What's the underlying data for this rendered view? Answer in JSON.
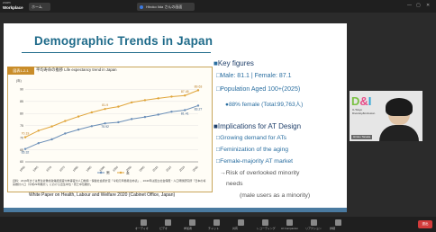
{
  "app": {
    "brand": "Workplace",
    "brand_small": "zoom"
  },
  "tabs": [
    {
      "label": "ホーム"
    },
    {
      "label": "Hiroko Iida さんの画面"
    }
  ],
  "slide": {
    "title": "Demographic Trends in Japan",
    "chart": {
      "tag": "図表1-2-1",
      "heading": "平均寿命の推移  Life expectancy trend in Japan",
      "note": "資料：2019年までは厚生労働省政策統括官付参事官付人口動態・保健社会統計室「令和元年簡易生命表」、2040年は国立社会保障・人口問題研究所「日本の将来推計人口（平成29年推計）」における出生中位・死亡中位推計。",
      "caption": "White Paper on Health, Labour and Welfare 2020 (Cabinet Office, Japan)"
    },
    "key_figures": {
      "title": "Key figures",
      "line1": "Male: 81.1 | Female: 87.1",
      "line2": "Population Aged 100+(2025)",
      "line3": "88% female (Total:99,763人)"
    },
    "implications": {
      "title": "Implications for AT Design",
      "items": [
        "Growing demand for ATs",
        "Feminization of the aging",
        "Female-majority AT market"
      ],
      "risk_line1": "Risk of overlooked minority",
      "risk_line2": "needs",
      "risk_line3": "(male users as a minority)"
    }
  },
  "chart_data": {
    "type": "line",
    "title": "平均寿命の推移 Life expectancy trend in Japan",
    "ylabel": "(年)",
    "categories": [
      "1960",
      "1965",
      "1970",
      "1975",
      "1980",
      "1985",
      "1990",
      "1995",
      "2000",
      "2005",
      "2010",
      "2015",
      "2019",
      "2040"
    ],
    "series": [
      {
        "name": "男",
        "values": [
          65.32,
          67.74,
          69.31,
          71.73,
          73.35,
          74.78,
          75.92,
          76.38,
          77.72,
          78.56,
          79.55,
          80.75,
          81.41,
          83.27
        ]
      },
      {
        "name": "女",
        "values": [
          70.19,
          72.92,
          74.66,
          76.89,
          78.76,
          80.48,
          81.9,
          82.85,
          84.6,
          85.52,
          86.3,
          86.99,
          87.45,
          89.63
        ]
      }
    ],
    "ylim": [
      60,
      92
    ],
    "yticks": [
      60,
      65,
      70,
      75,
      80,
      85,
      90
    ],
    "data_labels": [
      "65.32",
      "70.19",
      "81.9",
      "75.92",
      "87.45",
      "81.41",
      "89.63",
      "83.27"
    ],
    "legend": "bottom-center",
    "colors": {
      "male": "#6b8fb8",
      "female": "#e0a53a"
    }
  },
  "camera": {
    "name": "Hiroko Tanaka",
    "logo_text": "D&I",
    "logo_sub_1": "U-Tokyo",
    "logo_sub_2": "Diversity&Inclusion"
  },
  "toolbar": {
    "items": [
      "オーディオ",
      "ビデオ",
      "参加者",
      "チャット",
      "共有",
      "レコーディング",
      "AI Companion",
      "リアクション",
      "詳細"
    ],
    "leave": "退出"
  }
}
